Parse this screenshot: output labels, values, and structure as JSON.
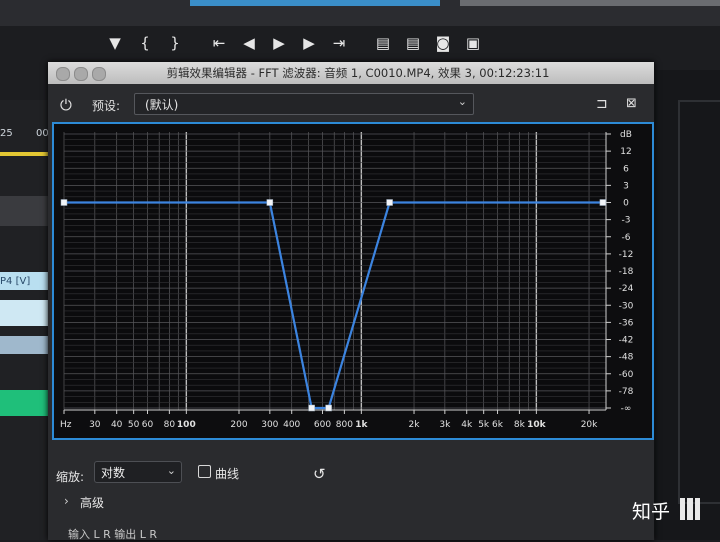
{
  "transport": {
    "buttons": [
      {
        "name": "mark-in-icon",
        "glyph": "▼"
      },
      {
        "name": "in-point-icon",
        "glyph": "{"
      },
      {
        "name": "out-point-icon",
        "glyph": "}"
      },
      {
        "name": "go-to-in-icon",
        "glyph": "⇤"
      },
      {
        "name": "step-back-icon",
        "glyph": "◀"
      },
      {
        "name": "play-icon",
        "glyph": "▶"
      },
      {
        "name": "step-forward-icon",
        "glyph": "▶"
      },
      {
        "name": "go-to-out-icon",
        "glyph": "⇥"
      },
      {
        "name": "insert-icon",
        "glyph": "▤"
      },
      {
        "name": "overwrite-icon",
        "glyph": "▤"
      },
      {
        "name": "camera-icon",
        "glyph": "◙"
      },
      {
        "name": "compare-icon",
        "glyph": "▣"
      }
    ]
  },
  "left_panel": {
    "items": [
      "25",
      "00",
      "P4 [V]"
    ]
  },
  "dialog": {
    "title": "剪辑效果编辑器 - FFT 滤波器: 音频 1, C0010.MP4, 效果 3, 00:12:23:11",
    "preset_label": "预设:",
    "preset_value": "(默认)",
    "scale_label": "缩放:",
    "scale_value": "对数",
    "curve_label": "曲线",
    "advanced_label": "高级",
    "cut_text": "输入 L R 输出 L R"
  },
  "chart_data": {
    "type": "line",
    "x_scale": "log",
    "xlim": [
      20,
      25000
    ],
    "x_ticks": [
      {
        "v": 20,
        "label": "Hz"
      },
      {
        "v": 30,
        "label": "30"
      },
      {
        "v": 40,
        "label": "40"
      },
      {
        "v": 50,
        "label": "50"
      },
      {
        "v": 60,
        "label": "60"
      },
      {
        "v": 80,
        "label": "80"
      },
      {
        "v": 100,
        "label": "100"
      },
      {
        "v": 200,
        "label": "200"
      },
      {
        "v": 300,
        "label": "300"
      },
      {
        "v": 400,
        "label": "400"
      },
      {
        "v": 600,
        "label": "600"
      },
      {
        "v": 800,
        "label": "800"
      },
      {
        "v": 1000,
        "label": "1k"
      },
      {
        "v": 2000,
        "label": "2k"
      },
      {
        "v": 3000,
        "label": "3k"
      },
      {
        "v": 4000,
        "label": "4k"
      },
      {
        "v": 5000,
        "label": "5k"
      },
      {
        "v": 6000,
        "label": "6k"
      },
      {
        "v": 8000,
        "label": "8k"
      },
      {
        "v": 10000,
        "label": "10k"
      },
      {
        "v": 20000,
        "label": "20k"
      }
    ],
    "bold_x": [
      100,
      1000,
      10000
    ],
    "y_ticks": [
      "dB",
      "12",
      "6",
      "3",
      "0",
      "-3",
      "-6",
      "-12",
      "-18",
      "-24",
      "-30",
      "-36",
      "-42",
      "-48",
      "-60",
      "-78",
      "-∞"
    ],
    "grid": true,
    "series": [
      {
        "color": "#3c84e0",
        "points": [
          {
            "f": 20,
            "db": "0"
          },
          {
            "f": 300,
            "db": "0"
          },
          {
            "f": 520,
            "db": "-∞"
          },
          {
            "f": 650,
            "db": "-∞"
          },
          {
            "f": 1450,
            "db": "0"
          },
          {
            "f": 24000,
            "db": "0"
          }
        ]
      }
    ]
  },
  "watermark": "知乎"
}
